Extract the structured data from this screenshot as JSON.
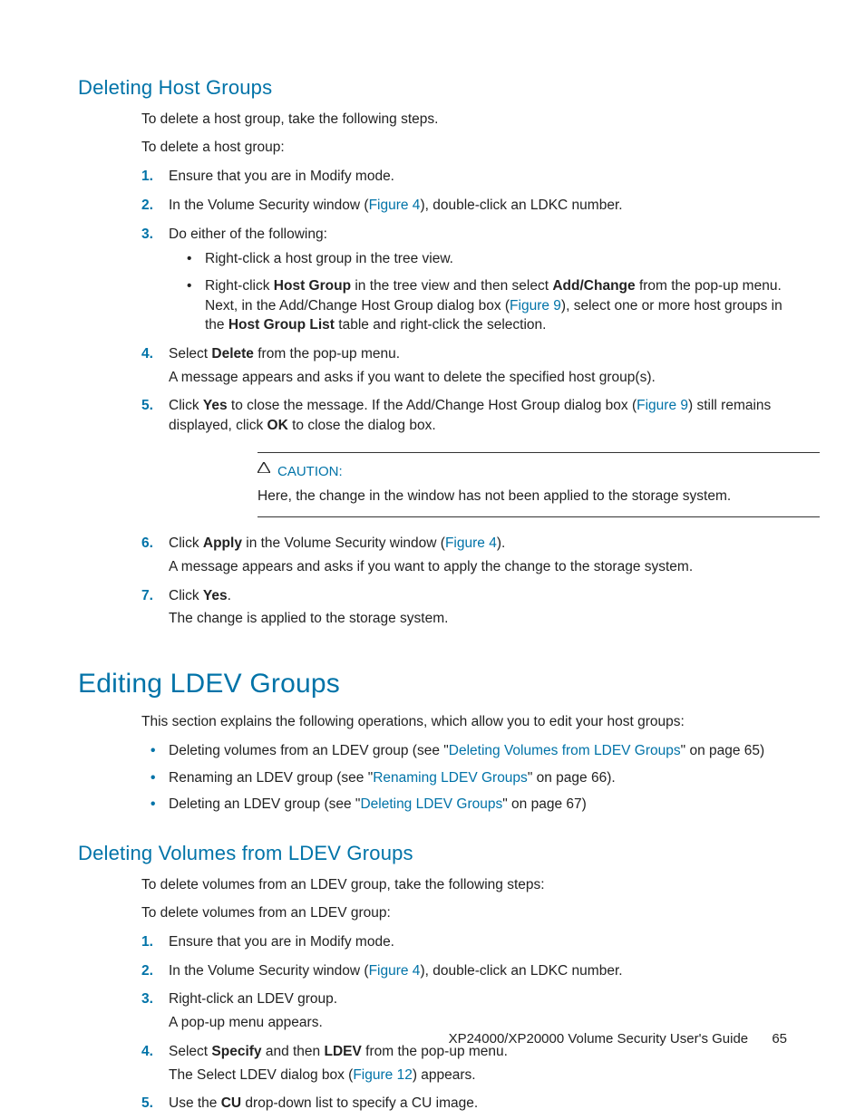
{
  "section1": {
    "title": "Deleting Host Groups",
    "intro1": "To delete a host group, take the following steps.",
    "intro2": "To delete a host group:",
    "steps": {
      "s1": "Ensure that you are in Modify mode.",
      "s2a": "In the Volume Security window (",
      "s2_link": "Figure 4",
      "s2b": "), double-click an LDKC number.",
      "s3": "Do either of the following:",
      "s3_b1": "Right-click a host group in the tree view.",
      "s3_b2a": "Right-click ",
      "s3_b2_bold1": "Host Group",
      "s3_b2b": " in the tree view and then select ",
      "s3_b2_bold2": "Add/Change",
      "s3_b2c": " from the pop-up menu. Next, in the Add/Change Host Group dialog box (",
      "s3_b2_link": "Figure 9",
      "s3_b2d": "), select one or more host groups in the ",
      "s3_b2_bold3": "Host Group List",
      "s3_b2e": " table and right-click the selection.",
      "s4a": "Select ",
      "s4_bold": "Delete",
      "s4b": " from the pop-up menu.",
      "s4_sub": "A message appears and asks if you want to delete the specified host group(s).",
      "s5a": "Click ",
      "s5_bold1": "Yes",
      "s5b": " to close the message. If the Add/Change Host Group dialog box (",
      "s5_link": "Figure 9",
      "s5c": ") still remains displayed, click ",
      "s5_bold2": "OK",
      "s5d": " to close the dialog box.",
      "caution_label": "CAUTION:",
      "caution_text": "Here, the change in the window has not been applied to the storage system.",
      "s6a": "Click ",
      "s6_bold": "Apply",
      "s6b": " in the Volume Security window (",
      "s6_link": "Figure 4",
      "s6c": ").",
      "s6_sub": "A message appears and asks if you want to apply the change to the storage system.",
      "s7a": "Click ",
      "s7_bold": "Yes",
      "s7b": ".",
      "s7_sub": "The change is applied to the storage system."
    }
  },
  "section2": {
    "title": "Editing LDEV Groups",
    "intro": "This section explains the following operations, which allow you to edit your host groups:",
    "items": {
      "i1a": "Deleting volumes from an LDEV group (see \"",
      "i1_link": "Deleting Volumes from LDEV Groups",
      "i1b": "\" on page 65)",
      "i2a": "Renaming an LDEV group (see \"",
      "i2_link": "Renaming LDEV Groups",
      "i2b": "\" on page 66).",
      "i3a": "Deleting an LDEV group (see \"",
      "i3_link": "Deleting LDEV Groups",
      "i3b": "\" on page 67)"
    }
  },
  "section3": {
    "title": "Deleting Volumes from LDEV Groups",
    "intro1": "To delete volumes from an LDEV group, take the following steps:",
    "intro2": "To delete volumes from an LDEV group:",
    "steps": {
      "s1": "Ensure that you are in Modify mode.",
      "s2a": "In the Volume Security window (",
      "s2_link": "Figure 4",
      "s2b": "), double-click an LDKC number.",
      "s3": "Right-click an LDEV group.",
      "s3_sub": "A pop-up menu appears.",
      "s4a": "Select ",
      "s4_bold1": "Specify",
      "s4b": " and then ",
      "s4_bold2": "LDEV",
      "s4c": " from the pop-up menu.",
      "s4_sub_a": "The Select LDEV dialog box (",
      "s4_sub_link": "Figure 12",
      "s4_sub_b": ") appears.",
      "s5a": "Use the ",
      "s5_bold": "CU",
      "s5b": " drop-down list to specify a CU image."
    }
  },
  "footer": {
    "doc": "XP24000/XP20000 Volume Security User's Guide",
    "page": "65"
  }
}
